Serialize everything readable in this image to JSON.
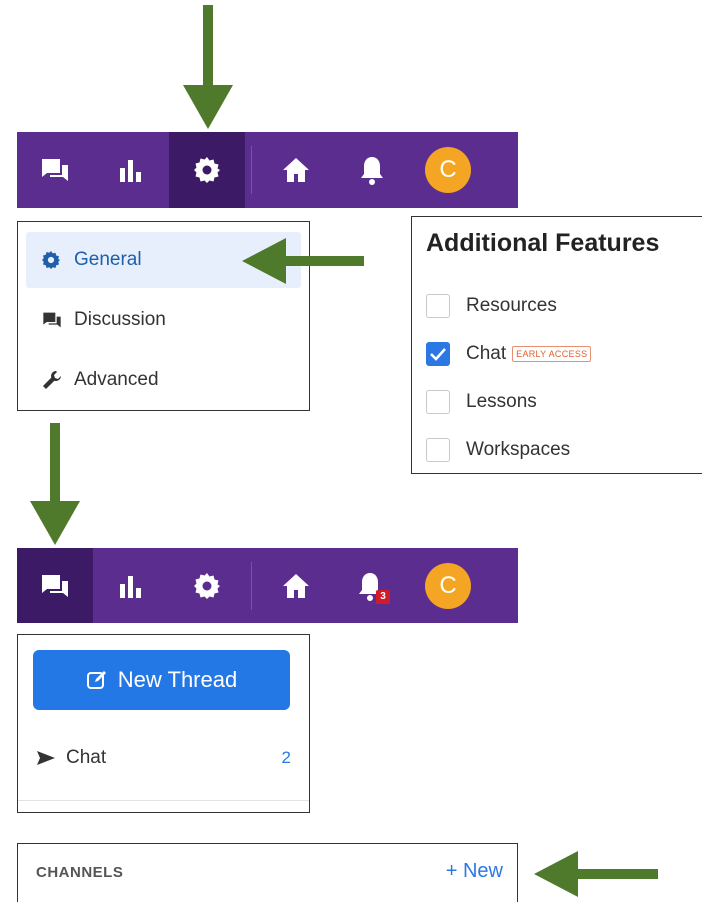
{
  "navbar_top": {
    "items": [
      {
        "name": "discussion",
        "active": false
      },
      {
        "name": "analytics",
        "active": false
      },
      {
        "name": "settings",
        "active": true
      },
      {
        "name": "home",
        "active": false
      },
      {
        "name": "notifications",
        "active": false
      }
    ],
    "avatar_initial": "C"
  },
  "settings_menu": {
    "items": [
      {
        "label": "General",
        "icon": "gear-icon",
        "active": true
      },
      {
        "label": "Discussion",
        "icon": "discussion-icon",
        "active": false
      },
      {
        "label": "Advanced",
        "icon": "wrench-icon",
        "active": false
      }
    ]
  },
  "additional_features": {
    "title": "Additional Features",
    "items": [
      {
        "label": "Resources",
        "checked": false
      },
      {
        "label": "Chat",
        "checked": true,
        "badge": "EARLY ACCESS"
      },
      {
        "label": "Lessons",
        "checked": false
      },
      {
        "label": "Workspaces",
        "checked": false
      }
    ]
  },
  "navbar_bottom": {
    "active": "discussion",
    "notification_count": "3",
    "avatar_initial": "C"
  },
  "chat_panel": {
    "new_thread_label": "New Thread",
    "chat_label": "Chat",
    "chat_count": "2"
  },
  "channels": {
    "label": "CHANNELS",
    "new_label": "+ New"
  },
  "colors": {
    "nav_bg": "#5b2d8f",
    "nav_active": "#3d1a66",
    "accent": "#2378e6",
    "avatar": "#f5a524",
    "arrow": "#4f7a2b",
    "badge": "#d11a2a"
  }
}
